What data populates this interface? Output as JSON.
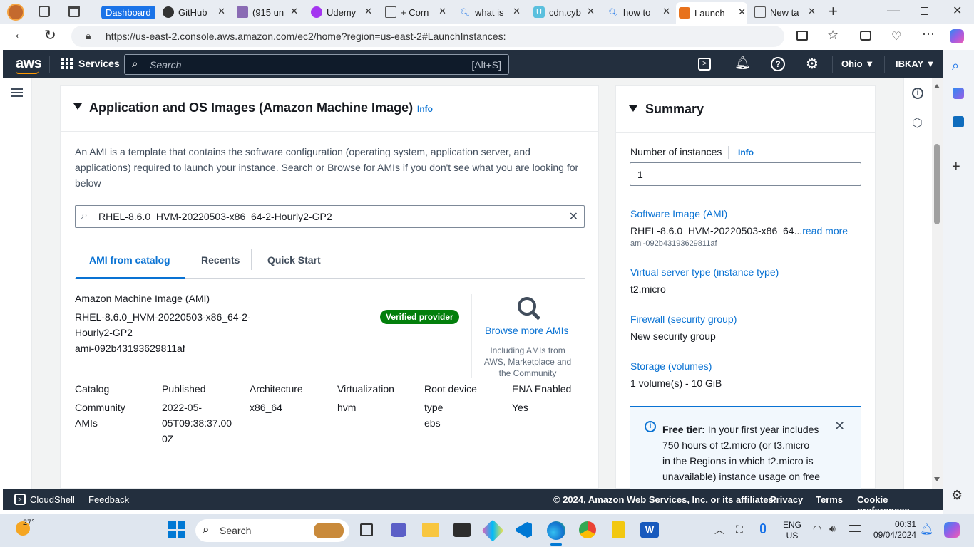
{
  "browser": {
    "tabs": [
      {
        "label": "Dashboard",
        "icon": "dashboard-icon"
      },
      {
        "label": "GitHub",
        "icon": "github-icon"
      },
      {
        "label": "(915 un",
        "icon": "mail-icon"
      },
      {
        "label": "Udemy",
        "icon": "udemy-icon"
      },
      {
        "label": "+ Corn",
        "icon": "doc-icon"
      },
      {
        "label": "what is",
        "icon": "search-icon"
      },
      {
        "label": "cdn.cyb",
        "icon": "u-icon"
      },
      {
        "label": "how to",
        "icon": "search-icon"
      },
      {
        "label": "Launch",
        "icon": "aws-icon"
      },
      {
        "label": "New ta",
        "icon": "newtab-icon"
      }
    ],
    "url": "https://us-east-2.console.aws.amazon.com/ec2/home?region=us-east-2#LaunchInstances:"
  },
  "aws": {
    "logo": "aws",
    "services": "Services",
    "search_placeholder": "Search",
    "search_shortcut": "[Alt+S]",
    "region": "Ohio ▼",
    "user": "IBKAY ▼"
  },
  "ami": {
    "title": "Application and OS Images (Amazon Machine Image)",
    "info": "Info",
    "description": "An AMI is a template that contains the software configuration (operating system, application server, and applications) required to launch your instance. Search or Browse for AMIs if you don't see what you are looking for below",
    "search_value": "RHEL-8.6.0_HVM-20220503-x86_64-2-Hourly2-GP2",
    "tabs": [
      "AMI from catalog",
      "Recents",
      "Quick Start"
    ],
    "label": "Amazon Machine Image (AMI)",
    "name_line1": "RHEL-8.6.0_HVM-20220503-x86_64-2-",
    "name_line2": "Hourly2-GP2",
    "id": "ami-092b43193629811af",
    "verified": "Verified provider",
    "browse": "Browse more AMIs",
    "browse_sub": [
      "Including AMIs from",
      "AWS, Marketplace and",
      "the Community"
    ],
    "columns": [
      {
        "header": "Catalog",
        "values": [
          "Community",
          "AMIs"
        ]
      },
      {
        "header": "Published",
        "values": [
          "2022-05-",
          "05T09:38:37.00",
          "0Z"
        ]
      },
      {
        "header": "Architecture",
        "values": [
          "x86_64"
        ]
      },
      {
        "header": "Virtualization",
        "values": [
          "hvm"
        ]
      },
      {
        "header": "Root device",
        "values": [
          "type",
          "ebs"
        ]
      },
      {
        "header": "ENA Enabled",
        "values": [
          "Yes"
        ]
      }
    ]
  },
  "summary": {
    "title": "Summary",
    "instances_label": "Number of instances",
    "info": "Info",
    "instances_value": "1",
    "software_label": "Software Image (AMI)",
    "software_value": "RHEL-8.6.0_HVM-20220503-x86_64...",
    "read_more": "read more",
    "software_id": "ami-092b43193629811af",
    "type_label": "Virtual server type (instance type)",
    "type_value": "t2.micro",
    "firewall_label": "Firewall (security group)",
    "firewall_value": "New security group",
    "storage_label": "Storage (volumes)",
    "storage_value": "1 volume(s) - 10 GiB",
    "free_tier_bold": "Free tier:",
    "free_tier_lines": [
      " In your first year includes",
      "750 hours of t2.micro (or t3.micro",
      "in the Regions in which t2.micro is",
      "unavailable) instance usage on free"
    ]
  },
  "footer": {
    "cloudshell": "CloudShell",
    "feedback": "Feedback",
    "copyright": "© 2024, Amazon Web Services, Inc. or its affiliates.",
    "privacy": "Privacy",
    "terms": "Terms",
    "cookies": "Cookie preferences"
  },
  "taskbar": {
    "weather": "27°",
    "search": "Search",
    "lang1": "ENG",
    "lang2": "US",
    "time": "00:31",
    "date": "09/04/2024"
  }
}
